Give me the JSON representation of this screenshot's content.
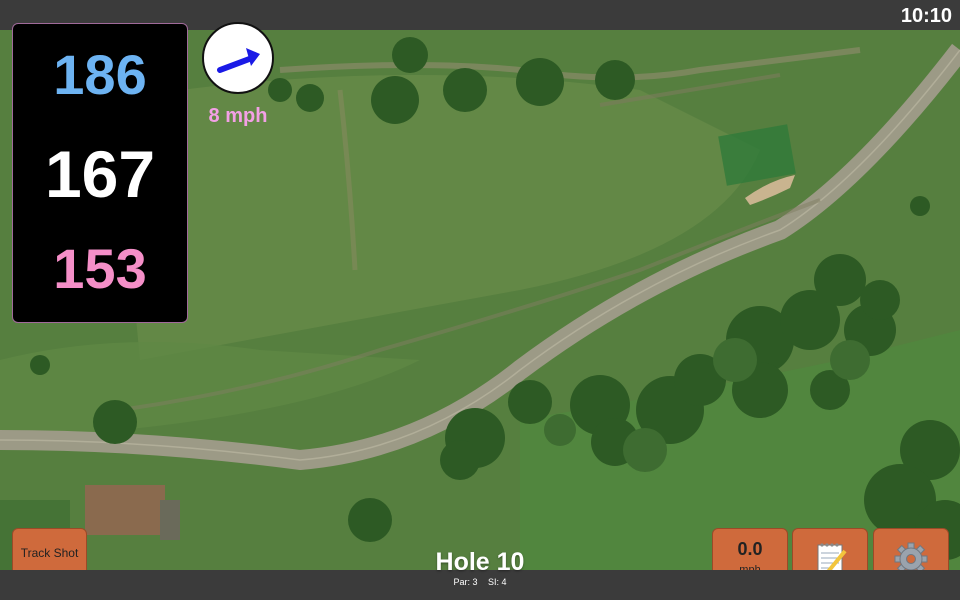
{
  "status": {
    "clock": "10:10"
  },
  "yardages": {
    "back": "186",
    "middle": "167",
    "front": "153"
  },
  "wind": {
    "speed": "8 mph",
    "direction_icon": "arrow-right-up"
  },
  "buttons": {
    "track_shot": "Track Shot",
    "speed_value": "0.0",
    "speed_unit": "mph",
    "notes_icon": "notepad-icon",
    "settings_icon": "gear-icon"
  },
  "hole": {
    "title": "Hole 10",
    "par": "Par: 3",
    "si": "SI: 4"
  },
  "colors": {
    "back": "#6db3f2",
    "middle": "#ffffff",
    "front": "#f58fc8",
    "wind_text": "#f3a0e6",
    "button": "#cf6a3c"
  }
}
